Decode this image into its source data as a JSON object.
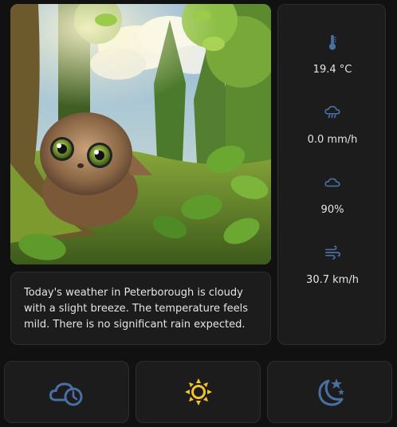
{
  "weather_summary": "Today's weather in Peterborough is cloudy with a slight breeze. The temperature feels mild. There is no significant rain expected.",
  "stats": [
    {
      "icon": "thermometer-icon",
      "value": "19.4 °C"
    },
    {
      "icon": "rain-cloud-icon",
      "value": "0.0 mm/h"
    },
    {
      "icon": "cloud-icon",
      "value": "90%"
    },
    {
      "icon": "wind-icon",
      "value": "30.7 km/h"
    }
  ],
  "buttons": [
    {
      "icon": "cloud-clock-icon"
    },
    {
      "icon": "sun-icon"
    },
    {
      "icon": "moon-stars-icon"
    }
  ],
  "colors": {
    "background": "#111111",
    "card": "#1c1c1c",
    "icon_blue": "#4a6fa5",
    "sun_yellow": "#f2c230",
    "text": "#e4e4e4"
  }
}
